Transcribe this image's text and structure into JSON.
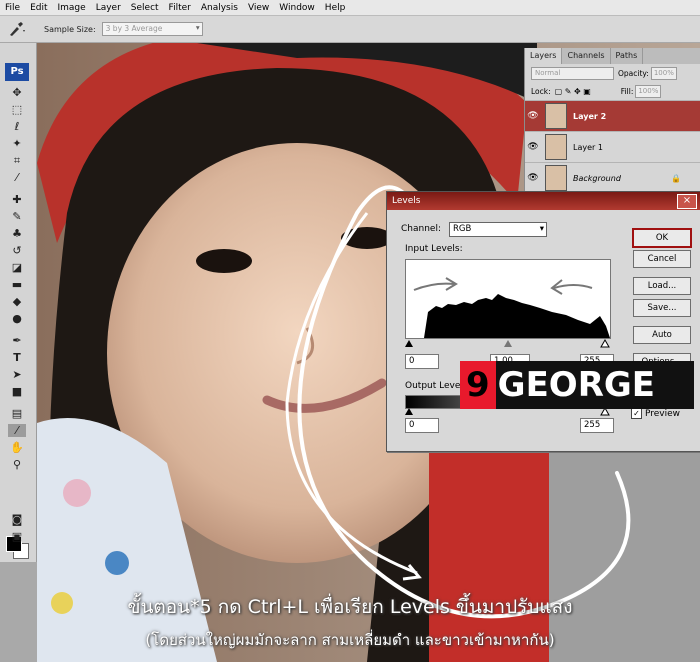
{
  "menu": [
    "File",
    "Edit",
    "Image",
    "Layer",
    "Select",
    "Filter",
    "Analysis",
    "View",
    "Window",
    "Help"
  ],
  "options_bar": {
    "tool_icon": "eyedropper-icon",
    "sample_size_label": "Sample Size:",
    "sample_size_value": "3 by 3 Average"
  },
  "tools": {
    "ps_logo": "Ps"
  },
  "layers_panel": {
    "tabs": [
      "Layers",
      "Channels",
      "Paths"
    ],
    "blend_mode": "Normal",
    "opacity_label": "Opacity:",
    "opacity_value": "100%",
    "lock_label": "Lock:",
    "fill_label": "Fill:",
    "fill_value": "100%",
    "layers": [
      {
        "name": "Layer 2",
        "selected": true
      },
      {
        "name": "Layer 1",
        "selected": false
      },
      {
        "name": "Background",
        "selected": false
      }
    ]
  },
  "levels_dialog": {
    "title": "Levels",
    "channel_label": "Channel:",
    "channel_value": "RGB",
    "input_levels_label": "Input Levels:",
    "input_black": "0",
    "input_gamma": "1.00",
    "input_white": "255",
    "output_levels_label": "Output Levels:",
    "output_black": "0",
    "output_white": "255",
    "buttons": {
      "ok": "OK",
      "cancel": "Cancel",
      "load": "Load...",
      "save": "Save...",
      "auto": "Auto",
      "options": "Options..."
    },
    "preview_label": "Preview",
    "preview_checked": true
  },
  "watermark": {
    "nine": "9",
    "text": "GEORGE"
  },
  "caption": {
    "line1": "ขั้นตอน*5 กด Ctrl+L เพื่อเรียก Levels ขึ้นมาปรับแสง",
    "line2": "(โดยส่วนใหญ่ผมมักจะลาก สามเหลี่ยมดำ และขาวเข้ามาหากัน)"
  },
  "colors": {
    "accent_red": "#a53a35",
    "title_red": "#9a2a22",
    "banner_red": "#e8192c"
  }
}
